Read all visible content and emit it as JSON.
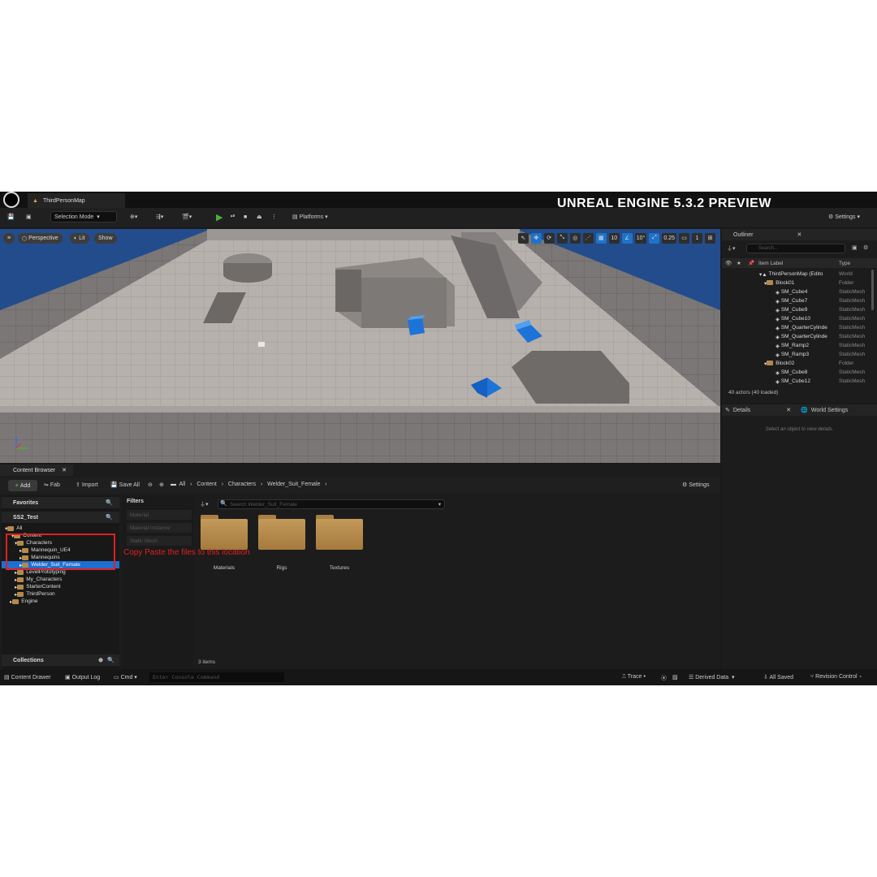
{
  "window": {
    "map_tab": "ThirdPersonMap",
    "brand": "UNREAL ENGINE 5.3.2 PREVIEW"
  },
  "toolbar": {
    "selection_mode": "Selection Mode",
    "platforms": "Platforms",
    "settings": "Settings"
  },
  "viewport": {
    "perspective": "Perspective",
    "lit": "Lit",
    "show": "Show",
    "grid_snap": "10",
    "rot_snap": "10°",
    "scale_snap": "0.25",
    "camera_speed": "1"
  },
  "outliner": {
    "title": "Outliner",
    "search_placeholder": "Search...",
    "col_label": "Item Label",
    "col_type": "Type",
    "rows": [
      {
        "label": "ThirdPersonMap (Edito",
        "type": "World"
      },
      {
        "label": "Block01",
        "type": "Folder"
      },
      {
        "label": "SM_Cube4",
        "type": "StaticMesh"
      },
      {
        "label": "SM_Cube7",
        "type": "StaticMesh"
      },
      {
        "label": "SM_Cube9",
        "type": "StaticMesh"
      },
      {
        "label": "SM_Cube10",
        "type": "StaticMesh"
      },
      {
        "label": "SM_QuarterCylinde",
        "type": "StaticMesh"
      },
      {
        "label": "SM_QuarterCylinde",
        "type": "StaticMesh"
      },
      {
        "label": "SM_Ramp2",
        "type": "StaticMesh"
      },
      {
        "label": "SM_Ramp3",
        "type": "StaticMesh"
      },
      {
        "label": "Block02",
        "type": "Folder"
      },
      {
        "label": "SM_Cube8",
        "type": "StaticMesh"
      },
      {
        "label": "SM_Cube12",
        "type": "StaticMesh"
      }
    ],
    "footer": "40 actors (40 loaded)"
  },
  "details": {
    "tab": "Details",
    "world_settings": "World Settings",
    "empty_msg": "Select an object to view details."
  },
  "content_browser": {
    "tab": "Content Browser",
    "add": "Add",
    "fab": "Fab",
    "import": "Import",
    "save_all": "Save All",
    "breadcrumb": [
      "All",
      "Content",
      "Characters",
      "Welder_Suit_Female"
    ],
    "settings": "Settings",
    "favorites": "Favorites",
    "project": "SS2_Test",
    "tree": [
      {
        "label": "All",
        "indent": 0
      },
      {
        "label": "Content",
        "indent": 1
      },
      {
        "label": "Characters",
        "indent": 2
      },
      {
        "label": "Mannequin_UE4",
        "indent": 3
      },
      {
        "label": "Mannequins",
        "indent": 3
      },
      {
        "label": "Welder_Suit_Female",
        "indent": 3,
        "selected": true
      },
      {
        "label": "LevelPrototyping",
        "indent": 2
      },
      {
        "label": "My_Characters",
        "indent": 2
      },
      {
        "label": "StarterContent",
        "indent": 2
      },
      {
        "label": "ThirdPerson",
        "indent": 2
      },
      {
        "label": "Engine",
        "indent": 1
      }
    ],
    "collections": "Collections",
    "filters_title": "Filters",
    "filters": [
      "Material",
      "Material Instance",
      "Static Mesh"
    ],
    "search_placeholder": "Search Welder_Suit_Female",
    "folders": [
      "Materials",
      "Rigs",
      "Textures"
    ],
    "item_count": "3 items",
    "annotation": "Copy Paste the files to this location"
  },
  "statusbar": {
    "content_drawer": "Content Drawer",
    "output_log": "Output Log",
    "cmd": "Cmd",
    "console_placeholder": "Enter Console Command",
    "trace": "Trace",
    "derived_data": "Derived Data",
    "all_saved": "All Saved",
    "revision_control": "Revision Control"
  }
}
